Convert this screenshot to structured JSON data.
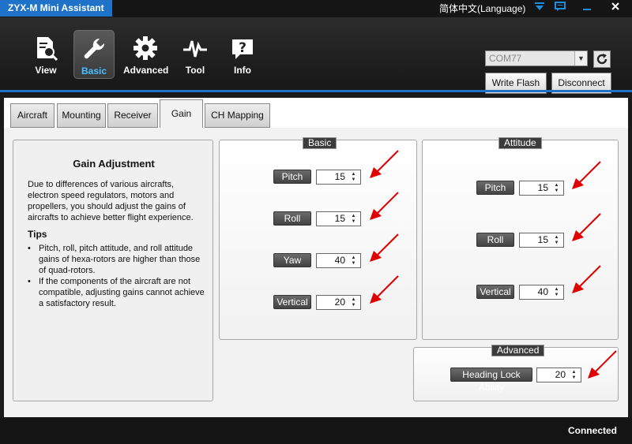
{
  "app": {
    "title": "ZYX-M Mini Assistant",
    "language": "简体中文(Language)"
  },
  "toolbar": {
    "items": [
      {
        "label": "View",
        "icon": "document-search-icon"
      },
      {
        "label": "Basic",
        "icon": "wrench-icon",
        "active": true
      },
      {
        "label": "Advanced",
        "icon": "gear-icon"
      },
      {
        "label": "Tool",
        "icon": "pulse-icon"
      },
      {
        "label": "Info",
        "icon": "question-bubble-icon"
      }
    ]
  },
  "connection": {
    "port": "COM77",
    "write_flash": "Write Flash",
    "disconnect": "Disconnect"
  },
  "tabs": [
    {
      "label": "Aircraft"
    },
    {
      "label": "Mounting"
    },
    {
      "label": "Receiver"
    },
    {
      "label": "Gain",
      "active": true
    },
    {
      "label": "CH Mapping"
    }
  ],
  "info": {
    "title": "Gain Adjustment",
    "body": "Due to differences of various aircrafts, electron speed regulators, motors and propellers, you should adjust the gains of aircrafts to achieve better flight experience.",
    "tips_title": "Tips",
    "tips": [
      "Pitch, roll, pitch attitude, and roll attitude gains of hexa-rotors are higher than those of quad-rotors.",
      "If the components of the aircraft are not compatible, adjusting gains cannot achieve a satisfactory result."
    ]
  },
  "basic": {
    "title": "Basic",
    "rows": [
      {
        "label": "Pitch",
        "value": "15"
      },
      {
        "label": "Roll",
        "value": "15"
      },
      {
        "label": "Yaw",
        "value": "40"
      },
      {
        "label": "Vertical",
        "value": "20"
      }
    ]
  },
  "attitude": {
    "title": "Attitude",
    "rows": [
      {
        "label": "Pitch",
        "value": "15"
      },
      {
        "label": "Roll",
        "value": "15"
      },
      {
        "label": "Vertical",
        "value": "40"
      }
    ]
  },
  "advanced": {
    "title": "Advanced",
    "rows": [
      {
        "label": "Heading Lock Ability",
        "value": "20"
      }
    ]
  },
  "status": {
    "text": "Connected"
  },
  "colors": {
    "accent": "#1e73c9",
    "arrow": "#e00000",
    "active_label": "#46c0ff"
  }
}
